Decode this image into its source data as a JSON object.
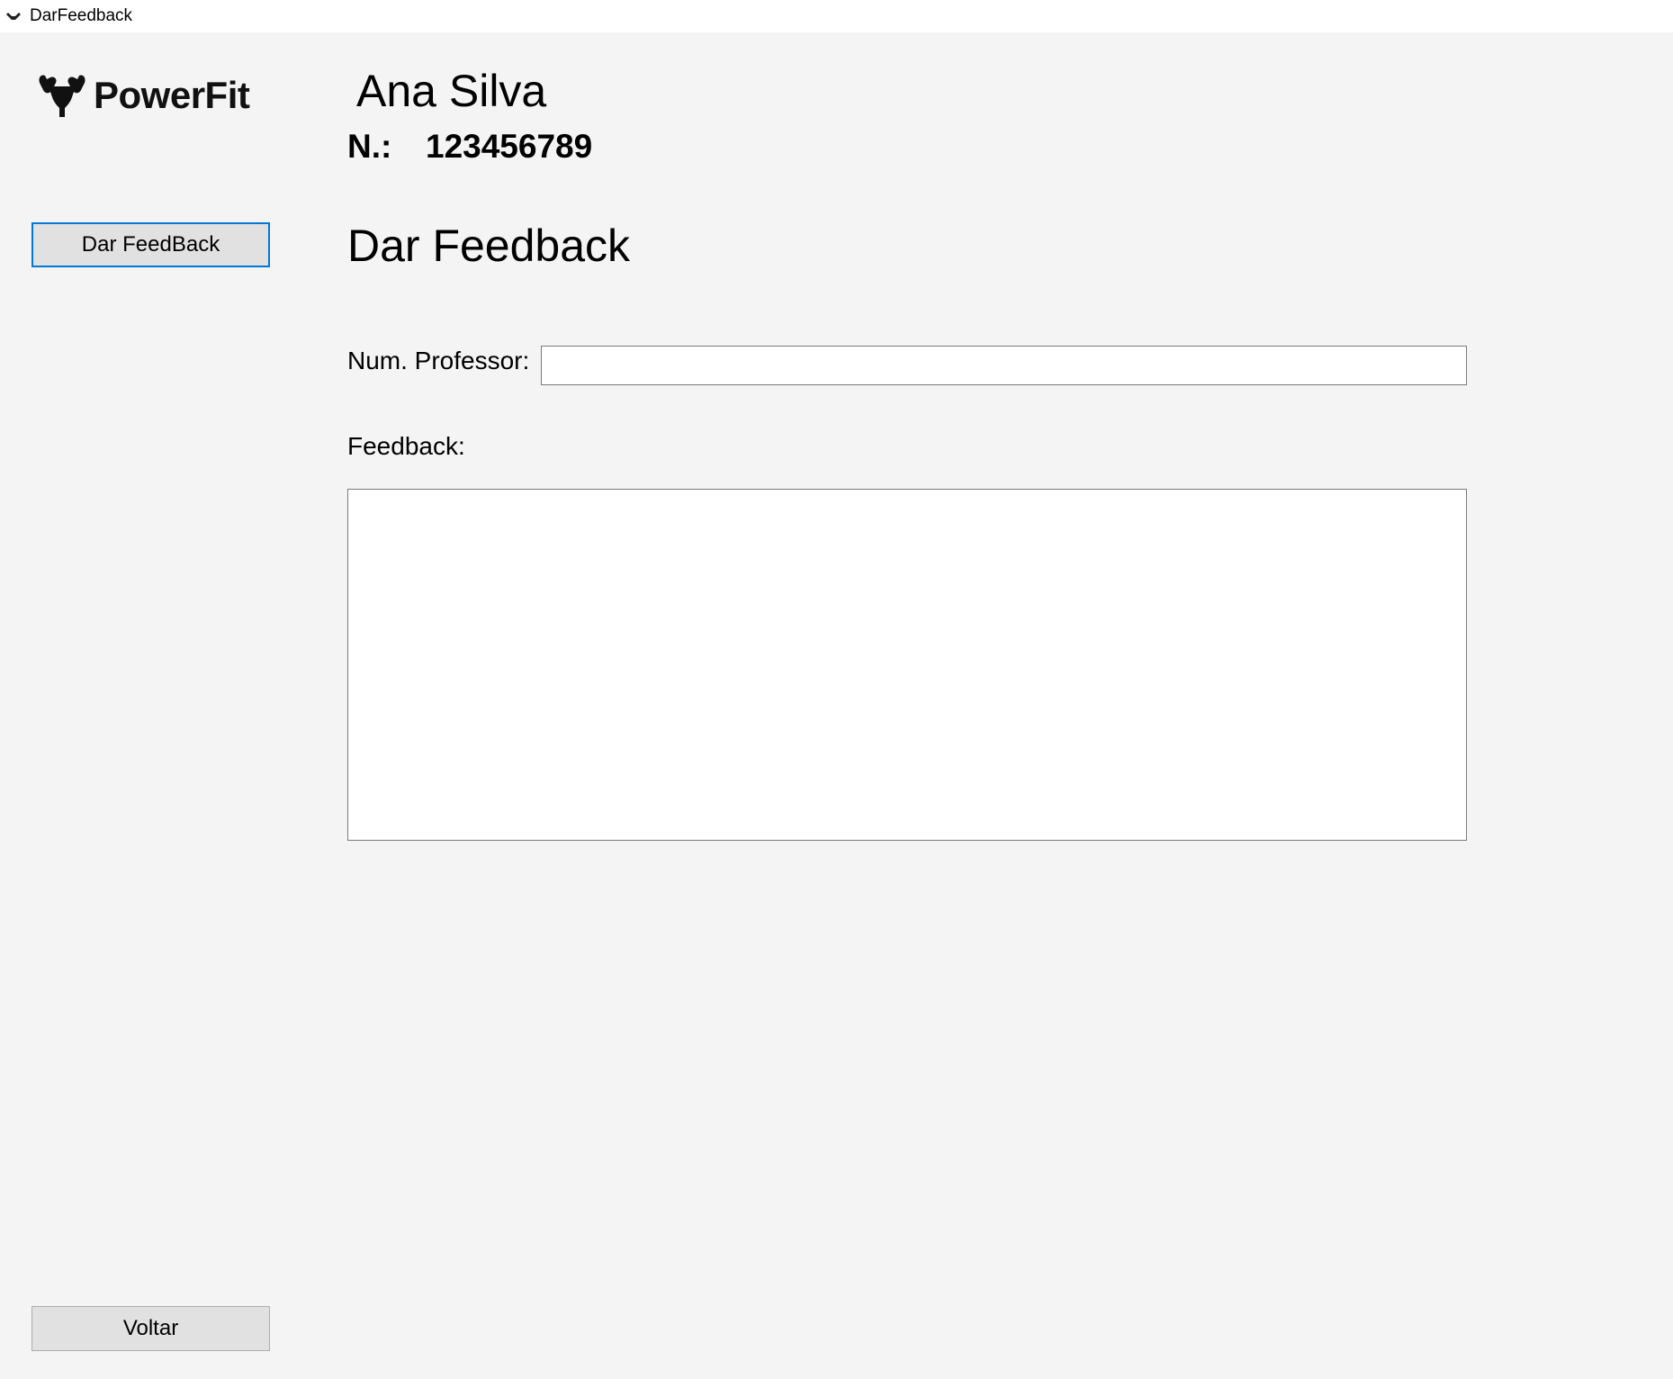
{
  "window": {
    "title": "DarFeedback",
    "icon": "powerfit-app-icon"
  },
  "brand": {
    "name": "PowerFit",
    "icon": "flexing-arm-icon"
  },
  "user": {
    "name": "Ana Silva",
    "number_label": "N.:",
    "number": "123456789"
  },
  "sidebar": {
    "give_feedback_label": "Dar FeedBack",
    "back_label": "Voltar"
  },
  "main": {
    "title": "Dar Feedback",
    "professor_label": "Num. Professor:",
    "professor_value": "",
    "feedback_label": "Feedback:",
    "feedback_value": ""
  },
  "colors": {
    "background": "#f4f4f4",
    "accent_focus": "#0078d7",
    "button_face": "#e1e1e1"
  }
}
